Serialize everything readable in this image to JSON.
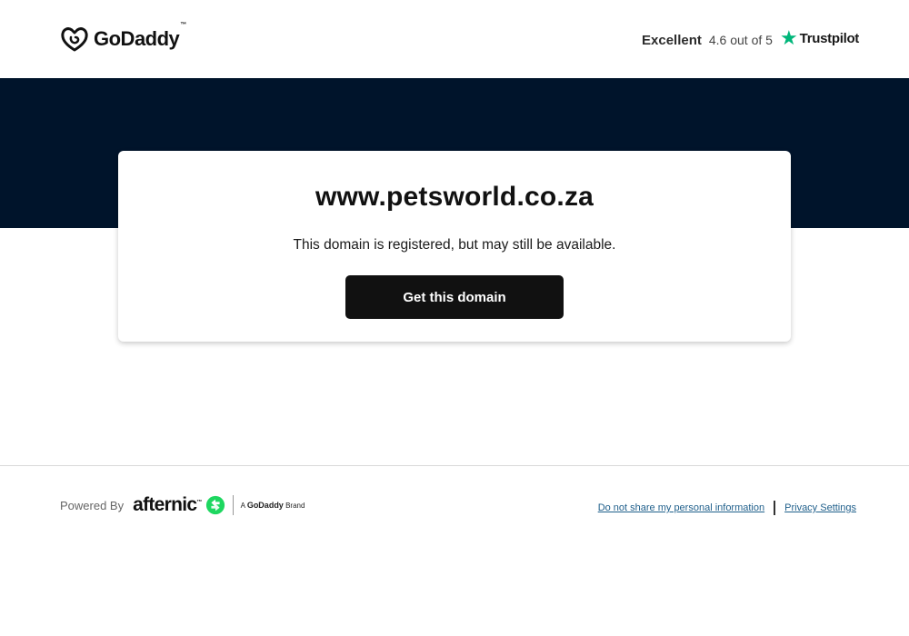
{
  "header": {
    "logo_text": "GoDaddy",
    "logo_tm": "™",
    "rating_label": "Excellent",
    "rating_score": "4.6 out of 5",
    "trustpilot_label": "Trustpilot"
  },
  "card": {
    "domain": "www.petsworld.co.za",
    "subtitle": "This domain is registered, but may still be available.",
    "cta_label": "Get this domain"
  },
  "footer": {
    "powered_by": "Powered By",
    "afternic_word": "afternic",
    "afternic_tm": "™",
    "brand_prefix": "A",
    "brand_name": "GoDaddy",
    "brand_suffix": "Brand",
    "links": [
      {
        "label": "Do not share my personal information"
      },
      {
        "label": "Privacy Settings"
      }
    ]
  },
  "colors": {
    "hero_bg": "#00142b",
    "cta_bg": "#111111",
    "trustpilot_green": "#00b67a",
    "afternic_green": "#1ed760",
    "link": "#1f5f8b"
  },
  "icons": [
    "godaddy-logo-icon",
    "trustpilot-star-icon",
    "afternic-arrows-icon"
  ]
}
